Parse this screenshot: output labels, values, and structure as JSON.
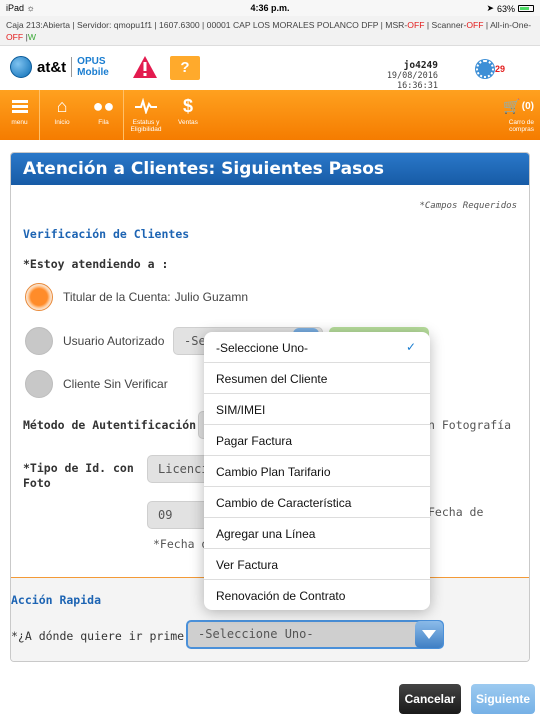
{
  "status_bar": {
    "device": "iPad",
    "wifi_icon": "wifi-icon",
    "time": "4:36 p.m.",
    "location_icon": "location-arrow-icon",
    "battery_text": "63%",
    "battery_level": 0.63
  },
  "info_bar": {
    "part1": "Caja 213:Abierta  |  Servidor: qmopu1f1  |  1607.6300  |  00001 CAP LOS MORALES POLANCO DFP  |  MSR-",
    "msr_status": "OFF",
    "part2": " |  Scanner-",
    "scanner_status": "OFF",
    "part3": " |  All-in-One- ",
    "allinone_status": "OFF",
    "part4": " |",
    "w_flag": "W"
  },
  "header": {
    "brand": "at&t",
    "app_name_line1": "OPUS",
    "app_name_line2": "Mobile",
    "username": "jo4249",
    "datetime": "19/08/2016 16:36:31",
    "notification_count": "29",
    "colors": {
      "accent_orange": "#f57c00",
      "brand_blue": "#1a7dd0",
      "alert_red": "#e31b1b"
    }
  },
  "nav": {
    "menu": "menu",
    "inicio": "Inicio",
    "fila": "Fila",
    "estatus_line1": "Estatus y",
    "estatus_line2": "Eligibilidad",
    "ventas": "Ventas",
    "cart_count": "(0)",
    "cart_line1": "Carro de",
    "cart_line2": "compras"
  },
  "form": {
    "title": "Atención a Clientes: Siguientes Pasos",
    "required_note": "*Campos Requeridos",
    "verification_title": "Verificación de Clientes",
    "attending_label": "*Estoy atendiendo a :",
    "radio_titular": "Titular de la Cuenta:",
    "titular_name": "Julio Guzamn",
    "radio_usuario": "Usuario Autorizado",
    "usuario_select_value": "-Se",
    "radio_sin_verificar": "Cliente Sin Verificar",
    "auth_method_label": "Método de Autentificación:",
    "auth_method_tail": "n Fotografía",
    "id_type_label_line1": "*Tipo de Id. con",
    "id_type_label_line2": "Foto",
    "id_type_value": "Licencia",
    "month_value": "09",
    "fecha_right": "Fecha de",
    "fecha_left": "*Fecha d",
    "quick_title": "Acción Rapida",
    "quick_question": "*¿A dónde quiere ir primero?",
    "quick_select_value": "-Seleccione Uno-"
  },
  "dropdown": {
    "selected_index": 0,
    "options": [
      "-Seleccione Uno-",
      "Resumen del Cliente",
      "SIM/IMEI",
      "Pagar Factura",
      "Cambio Plan Tarifario",
      "Cambio de Característica",
      "Agregar una Línea",
      "Ver Factura",
      "Renovación de Contrato"
    ]
  },
  "buttons": {
    "cancel": "Cancelar",
    "next": "Siguiente"
  }
}
